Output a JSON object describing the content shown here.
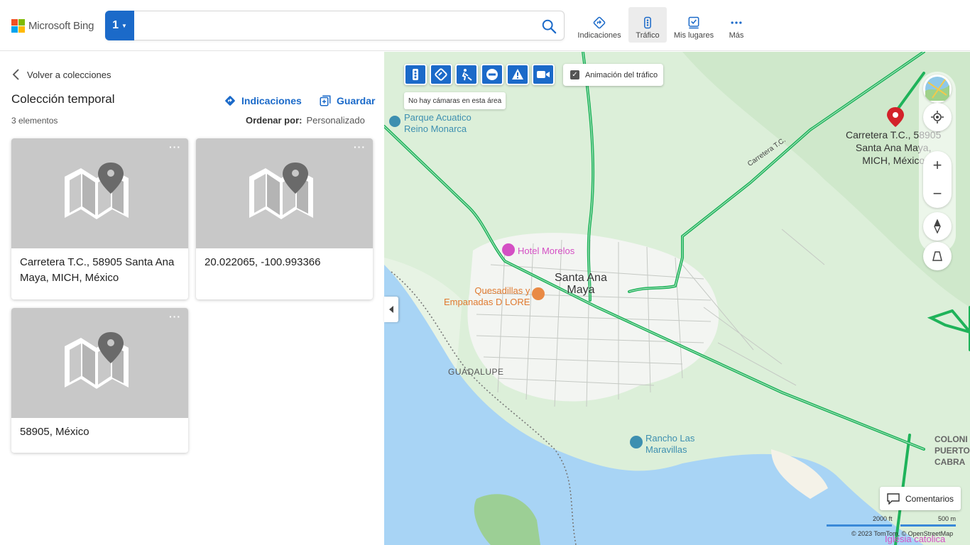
{
  "header": {
    "brand": "Microsoft Bing",
    "search": {
      "scope_label": "1",
      "value": "",
      "placeholder": ""
    },
    "nav": [
      {
        "label": "Indicaciones",
        "icon": "directions-icon"
      },
      {
        "label": "Tráfico",
        "icon": "traffic-icon",
        "active": true
      },
      {
        "label": "Mis lugares",
        "icon": "my-places-icon"
      },
      {
        "label": "Más",
        "icon": "more-icon"
      }
    ]
  },
  "collection": {
    "back_label": "Volver a colecciones",
    "title": "Colección temporal",
    "count": "3 elementos",
    "directions_label": "Indicaciones",
    "save_label": "Guardar",
    "sort_label": "Ordenar por:",
    "sort_value": "Personalizado",
    "items": [
      {
        "label": "Carretera T.C., 58905 Santa Ana Maya, MICH, México",
        "more": "···"
      },
      {
        "label": "20.022065, -100.993366",
        "more": "···"
      },
      {
        "label": "58905, México",
        "more": "···"
      }
    ]
  },
  "map": {
    "traffic_animation_label": "Animación del tráfico",
    "traffic_animation_checked": true,
    "camera_note": "No hay cámaras en esta área",
    "labels": {
      "parque": "Parque Acuatico\nReino Monarca",
      "hotel": "Hotel Morelos",
      "town": "Santa Ana\nMaya",
      "quesadillas": "Quesadillas y\nEmpanadas D LORE",
      "guadalupe": "GUADALUPE",
      "rancho": "Rancho Las\nMaravillas",
      "road": "Carretera T.C.",
      "pin_address": "Carretera T.C., 58905\nSanta Ana Maya,\nMICH, México",
      "colonia": "COLONI\nPUERTO\nCABRA",
      "iglesia": "Iglesia catolica"
    },
    "feedback_label": "Comentarios",
    "scale_ft": "2000 ft",
    "scale_m": "500 m",
    "copyright": "© 2023 TomTom,  © OpenStreetMap"
  },
  "colors": {
    "accent": "#1b6ac9",
    "traffic_green": "#1fb35a",
    "water": "#a8d4f5",
    "land": "#dff0dc",
    "pin": "#d3222a"
  }
}
